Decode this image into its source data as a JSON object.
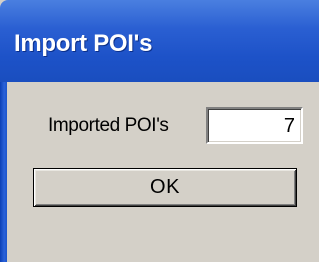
{
  "window": {
    "title": "Import POI's"
  },
  "form": {
    "imported_label": "Imported POI's",
    "imported_value": "7"
  },
  "buttons": {
    "ok_label": "OK"
  },
  "colors": {
    "titlebar": "#1d52c8",
    "dialog_bg": "#d4d0c8"
  }
}
